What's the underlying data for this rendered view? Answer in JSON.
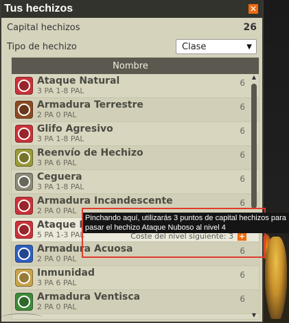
{
  "window": {
    "title": "Tus hechizos",
    "close_label": "✕"
  },
  "capital": {
    "label": "Capital hechizos",
    "value": "26"
  },
  "type_filter": {
    "label": "Tipo de hechizo",
    "selected": "Clase"
  },
  "list": {
    "header": "Nombre",
    "spells": [
      {
        "name": "Ataque Natural",
        "meta": "3 PA   1-8 PAL",
        "level": "6",
        "color": "#c9333b",
        "selected": false
      },
      {
        "name": "Armadura Terrestre",
        "meta": "2 PA   0 PAL",
        "level": "6",
        "color": "#8a4b24",
        "selected": false
      },
      {
        "name": "Glifo Agresivo",
        "meta": "3 PA   1-8 PAL",
        "level": "6",
        "color": "#c9333b",
        "selected": false
      },
      {
        "name": "Reenvío de Hechizo",
        "meta": "3 PA   6 PAL",
        "level": "6",
        "color": "#9a9a3a",
        "selected": false
      },
      {
        "name": "Ceguera",
        "meta": "3 PA   1-8 PAL",
        "level": "6",
        "color": "#8c8a78",
        "selected": false
      },
      {
        "name": "Armadura Incandescente",
        "meta": "2 PA   0 PAL",
        "level": "6",
        "color": "#c9333b",
        "selected": false
      },
      {
        "name": "Ataque Nuboso",
        "meta": "5 PA   1-3 PAL",
        "level": "3",
        "color": "#c9333b",
        "selected": true
      },
      {
        "name": "Armadura Acuosa",
        "meta": "2 PA   0 PAL",
        "level": "6",
        "color": "#2f5fbf",
        "selected": false
      },
      {
        "name": "Inmunidad",
        "meta": "3 PA   6 PAL",
        "level": "6",
        "color": "#c7a34b",
        "selected": false
      },
      {
        "name": "Armadura Ventisca",
        "meta": "2 PA   0 PAL",
        "level": "6",
        "color": "#3f8a3a",
        "selected": false
      }
    ]
  },
  "upgrade": {
    "cost_label": "Coste del nivel siguiente: 3",
    "plus": "+"
  },
  "tooltip": {
    "text": "Pinchando aquí, utilizarás 3 puntos de capital hechizos para pasar el hechizo Ataque Nuboso al nivel 4"
  },
  "scrollbar": {
    "up": "▲",
    "down": "▼"
  }
}
